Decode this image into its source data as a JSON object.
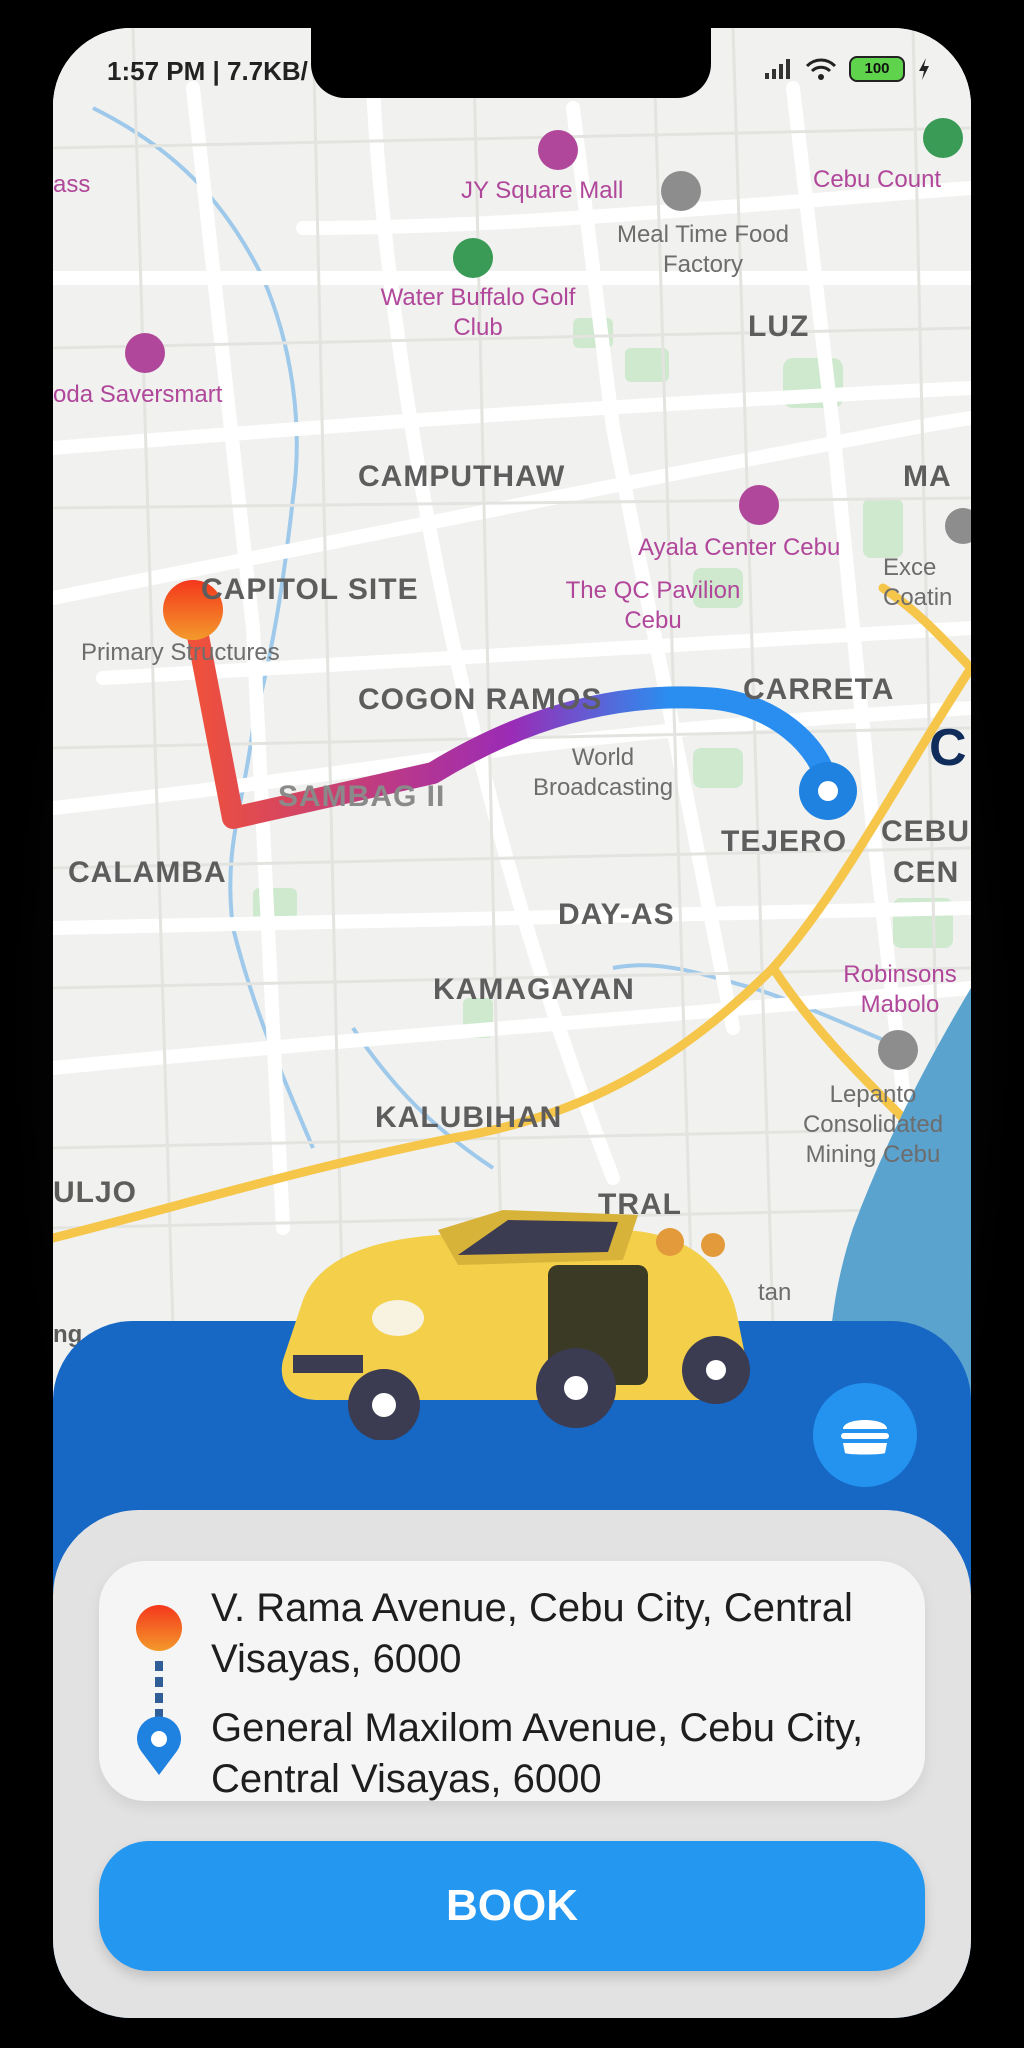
{
  "status_bar": {
    "time_speed": "1:57 PM | 7.7KB/",
    "battery_level": "100",
    "icons": [
      "signal-icon",
      "wifi-icon",
      "battery-icon",
      "charging-icon"
    ]
  },
  "map": {
    "areas": [
      "CAMPUTHAW",
      "CAPITOL SITE",
      "COGON RAMOS",
      "CARRETA",
      "TEJERO",
      "CALAMBA",
      "DAY-AS",
      "KAMAGAYAN",
      "KALUBIHAN",
      "LUZ",
      "ULJO",
      "TRAL",
      "MA",
      "CEBU",
      "CEN",
      "SAMBAG II",
      "C"
    ],
    "pois": [
      "JY Square Mall",
      "Water Buffalo Golf Club",
      "oda Saversmart",
      "Ayala Center Cebu",
      "The QC Pavilion Cebu",
      "Cebu Count",
      "Robinsons Mabolo",
      "ass",
      "ng"
    ],
    "gray_pois": [
      "Meal Time Food Factory",
      "Primary Structures",
      "World Broadcasting",
      "Exce Coatin",
      "Lepanto Consolidated Mining Cebu",
      "tan"
    ],
    "route_colors": {
      "start": "#f0513a",
      "mid": "#9b2bb6",
      "end": "#2a8ef0"
    }
  },
  "trip": {
    "pickup": "V. Rama Avenue, Cebu City, Central Visayas, 6000",
    "destination": "General Maxilom Avenue, Cebu City, Central Visayas, 6000"
  },
  "actions": {
    "book_label": "BOOK",
    "menu_icon": "burger-icon"
  },
  "colors": {
    "panel_blue": "#1767c4",
    "button_blue": "#2497f1"
  }
}
